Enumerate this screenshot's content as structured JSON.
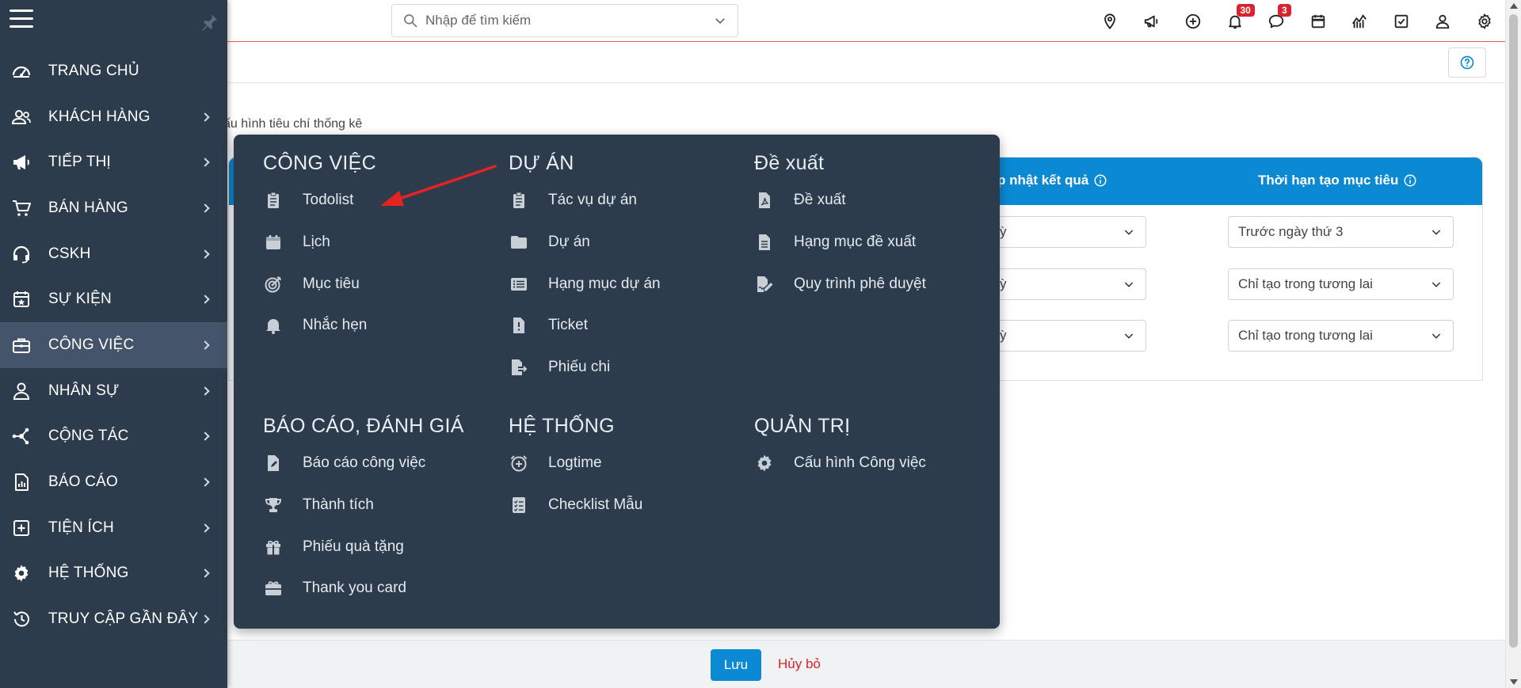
{
  "search": {
    "placeholder": "Nhập để tìm kiếm"
  },
  "topbar": {
    "icons": [
      "location-icon",
      "megaphone-icon",
      "add-circle-icon",
      "bell-icon",
      "chat-icon",
      "calendar-icon",
      "chart-icon",
      "checkbox-icon",
      "user-icon",
      "settings-icon"
    ],
    "notifications_badge": "30",
    "messages_badge": "3"
  },
  "colors": {
    "sidebar": "#2d3c4c",
    "sidebar_active": "#44546a",
    "accent": "#0b8ad3",
    "danger": "#d9232e",
    "topbar_border": "#e8613f"
  },
  "sidebar": {
    "items": [
      {
        "label": "TRANG CHỦ",
        "icon": "dashboard-icon",
        "submenu": false
      },
      {
        "label": "KHÁCH HÀNG",
        "icon": "users-icon",
        "submenu": true
      },
      {
        "label": "TIẾP THỊ",
        "icon": "megaphone-icon",
        "submenu": true
      },
      {
        "label": "BÁN HÀNG",
        "icon": "cart-icon",
        "submenu": true
      },
      {
        "label": "CSKH",
        "icon": "headset-icon",
        "submenu": true
      },
      {
        "label": "SỰ KIỆN",
        "icon": "calendar-event-icon",
        "submenu": true
      },
      {
        "label": "CÔNG VIỆC",
        "icon": "briefcase-icon",
        "submenu": true,
        "active": true
      },
      {
        "label": "NHÂN SỰ",
        "icon": "person-icon",
        "submenu": true
      },
      {
        "label": "CỘNG TÁC",
        "icon": "network-icon",
        "submenu": true
      },
      {
        "label": "BÁO CÁO",
        "icon": "report-icon",
        "submenu": true
      },
      {
        "label": "TIỆN ÍCH",
        "icon": "plus-square-icon",
        "submenu": true
      },
      {
        "label": "HỆ THỐNG",
        "icon": "gear-icon",
        "submenu": true
      },
      {
        "label": "TRUY CẬP GẦN ĐÂY",
        "icon": "history-icon",
        "submenu": true
      }
    ]
  },
  "page": {
    "section_caption": "ấu hình tiêu chí thống kê",
    "table": {
      "headers": [
        "p nhật kết quả",
        "Thời hạn tạo mục tiêu"
      ],
      "rows": [
        {
          "col1": "ỳ",
          "col2": "Trước ngày thứ 3"
        },
        {
          "col1": "ỳ",
          "col2": "Chỉ tạo trong tương lai"
        },
        {
          "col1": "ỳ",
          "col2": "Chỉ tạo trong tương lai"
        }
      ]
    }
  },
  "footer": {
    "save_label": "Lưu",
    "cancel_label": "Hủy bỏ"
  },
  "mega_menu": {
    "columns": [
      {
        "title": "CÔNG VIỆC",
        "items": [
          {
            "label": "Todolist",
            "icon": "clipboard-list-icon"
          },
          {
            "label": "Lịch",
            "icon": "calendar-icon"
          },
          {
            "label": "Mục tiêu",
            "icon": "target-icon"
          },
          {
            "label": "Nhắc hẹn",
            "icon": "bell-icon"
          }
        ]
      },
      {
        "title": "DỰ ÁN",
        "items": [
          {
            "label": "Tác vụ dự án",
            "icon": "clipboard-list-icon"
          },
          {
            "label": "Dự án",
            "icon": "folder-icon"
          },
          {
            "label": "Hạng mục dự án",
            "icon": "list-alt-icon"
          },
          {
            "label": "Ticket",
            "icon": "file-exclamation-icon"
          },
          {
            "label": "Phiếu chi",
            "icon": "file-export-icon"
          }
        ]
      },
      {
        "title": "Đề xuất",
        "items": [
          {
            "label": "Đề xuất",
            "icon": "file-pdf-icon"
          },
          {
            "label": "Hạng mục đề xuất",
            "icon": "file-text-icon"
          },
          {
            "label": "Quy trình phê duyệt",
            "icon": "file-signature-icon"
          }
        ]
      },
      {
        "title": "BÁO CÁO, ĐÁNH GIÁ",
        "items": [
          {
            "label": "Báo cáo công việc",
            "icon": "file-edit-icon"
          },
          {
            "label": "Thành tích",
            "icon": "trophy-icon"
          },
          {
            "label": "Phiếu quà tặng",
            "icon": "gift-icon"
          },
          {
            "label": "Thank you card",
            "icon": "gift-card-icon"
          }
        ]
      },
      {
        "title": "HỆ THỐNG",
        "items": [
          {
            "label": "Logtime",
            "icon": "alarm-plus-icon"
          },
          {
            "label": "Checklist Mẫu",
            "icon": "checklist-icon"
          }
        ]
      },
      {
        "title": "QUẢN TRỊ",
        "items": [
          {
            "label": "Cấu hình Công việc",
            "icon": "gear-icon"
          }
        ]
      }
    ]
  }
}
